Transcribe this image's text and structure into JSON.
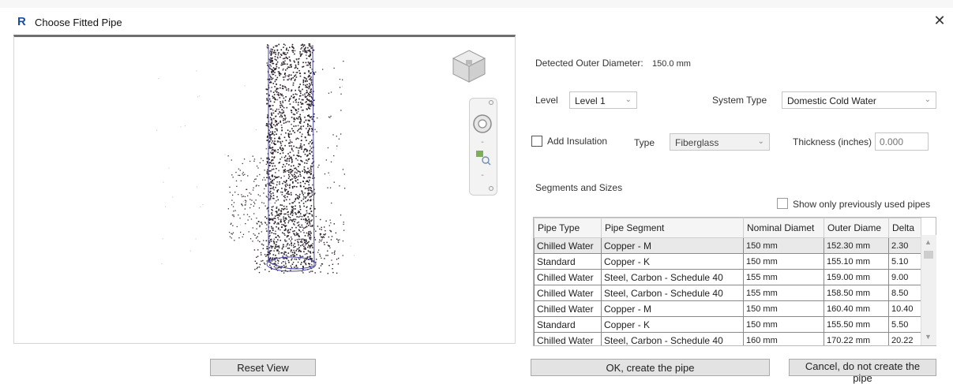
{
  "window": {
    "app_icon": "R",
    "title": "Choose Fitted Pipe",
    "close": "✕"
  },
  "viewport": {
    "reset_view": "Reset View"
  },
  "detected": {
    "label": "Detected Outer Diameter:",
    "value": "150.0 mm"
  },
  "level": {
    "label": "Level",
    "value": "Level 1"
  },
  "system_type": {
    "label": "System Type",
    "value": "Domestic Cold Water"
  },
  "insulation": {
    "checkbox_label": "Add Insulation",
    "checked": false,
    "type_label": "Type",
    "type_value": "Fiberglass",
    "thickness_label": "Thickness (inches)",
    "thickness_placeholder": "0.000"
  },
  "segments": {
    "heading": "Segments and Sizes",
    "show_only_label": "Show only previously used pipes"
  },
  "table": {
    "headers": [
      "Pipe Type",
      "Pipe Segment",
      "Nominal Diamet",
      "Outer Diame",
      "Delta"
    ],
    "rows": [
      [
        "Chilled Water",
        "Copper - M",
        "150 mm",
        "152.30 mm",
        "2.30"
      ],
      [
        "Standard",
        "Copper - K",
        "150 mm",
        "155.10 mm",
        "5.10"
      ],
      [
        "Chilled Water",
        "Steel, Carbon - Schedule 40",
        "155 mm",
        "159.00 mm",
        "9.00"
      ],
      [
        "Chilled Water",
        "Steel, Carbon - Schedule 40",
        "155 mm",
        "158.50 mm",
        "8.50"
      ],
      [
        "Chilled Water",
        "Copper - M",
        "150 mm",
        "160.40 mm",
        "10.40"
      ],
      [
        "Standard",
        "Copper - K",
        "150 mm",
        "155.50 mm",
        "5.50"
      ],
      [
        "Chilled Water",
        "Steel, Carbon - Schedule 40",
        "160 mm",
        "170.22 mm",
        "20.22"
      ]
    ]
  },
  "buttons": {
    "ok": "OK, create the pipe",
    "cancel": "Cancel, do not create the pipe"
  },
  "icons": {
    "viewcube": "viewcube-icon",
    "steering": "steering-wheel-icon",
    "zoom": "zoom-region-icon",
    "chevron": "chevron-down-icon"
  }
}
